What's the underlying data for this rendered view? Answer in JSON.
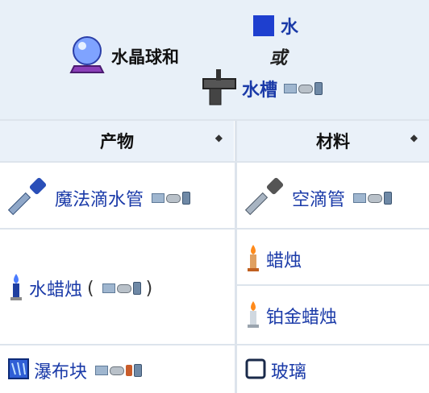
{
  "header": {
    "crafting_station_label": "水晶球和",
    "alt_water_label": "水",
    "or_label": "或",
    "sink_label": "水槽"
  },
  "columns": {
    "product": "产物",
    "materials": "材料",
    "sort_glyph": "◆"
  },
  "rows": [
    {
      "product": "魔法滴水管",
      "material": "空滴管"
    },
    {
      "product": "水蜡烛",
      "paren_open": "(",
      "paren_close": ")",
      "materials": [
        "蜡烛",
        "铂金蜡烛"
      ]
    },
    {
      "product": "瀑布块",
      "material": "玻璃"
    }
  ],
  "icons": {
    "crystal_ball": "crystal-ball-icon",
    "water": "water-square-icon",
    "sink": "sink-icon",
    "dropper": "dropper-icon",
    "candle": "candle-icon",
    "waterfall_block": "waterfall-block-icon",
    "glass": "glass-block-icon",
    "platforms": [
      "desktop-icon",
      "console-icon",
      "mobile-icon"
    ]
  },
  "colors": {
    "header_bg": "#e8f0f8",
    "link": "#1a3aa8",
    "water": "#1e3fcf"
  }
}
